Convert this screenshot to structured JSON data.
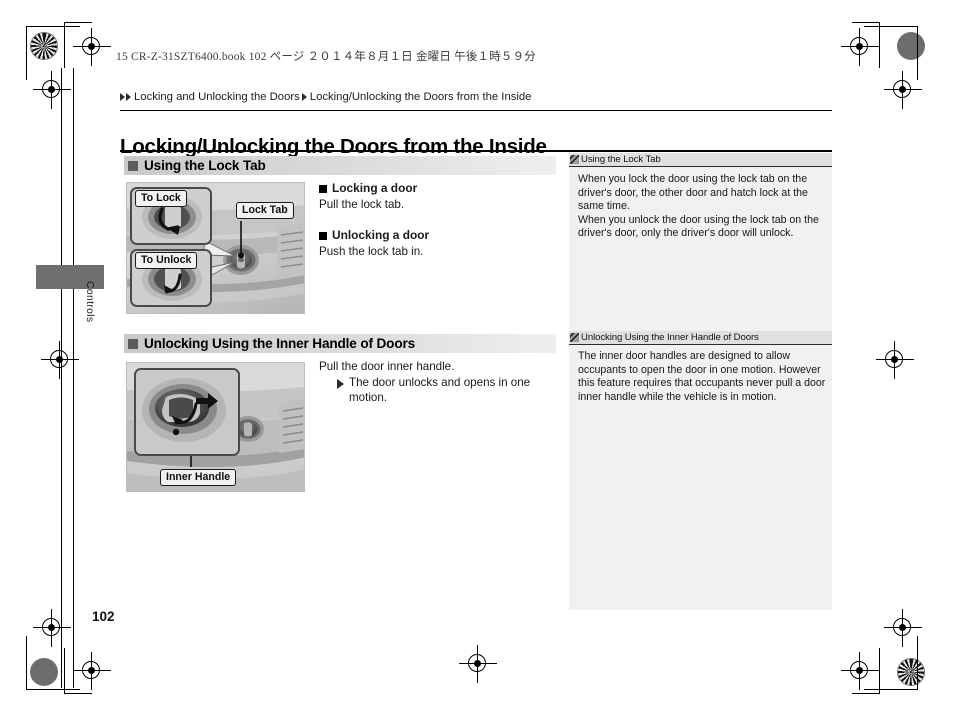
{
  "print_header": "15 CR-Z-31SZT6400.book   102 ページ   ２０１４年８月１日   金曜日   午後１時５９分",
  "breadcrumb": {
    "level1": "Locking and Unlocking the Doors",
    "level2": "Locking/Unlocking the Doors from the Inside"
  },
  "page_title": "Locking/Unlocking the Doors from the Inside",
  "thumb_tab_label": "Controls",
  "folio": "102",
  "sections": [
    {
      "heading": "Using the Lock Tab",
      "illustration": {
        "name": "lock-tab-illustration",
        "callout": "Lock Tab",
        "inset_top_label": "To Lock",
        "inset_bottom_label": "To Unlock"
      },
      "blocks": [
        {
          "subhead": "Locking a door",
          "text": "Pull the lock tab."
        },
        {
          "subhead": "Unlocking a door",
          "text": "Push the lock tab in."
        }
      ]
    },
    {
      "heading": "Unlocking Using the Inner Handle of Doors",
      "illustration": {
        "name": "inner-handle-illustration",
        "callout": "Inner Handle"
      },
      "instruction": "Pull the door inner handle.",
      "result": "The door unlocks and opens in one motion."
    }
  ],
  "sidebar": [
    {
      "heading": "Using the Lock Tab",
      "paragraphs": [
        "When you lock the door using the lock tab on the driver's door, the other door and hatch lock at the same time.",
        "When you unlock the door using the lock tab on the driver's door, only the driver's door will unlock."
      ]
    },
    {
      "heading": "Unlocking Using the Inner Handle of Doors",
      "paragraphs": [
        "The inner door handles are designed to allow occupants to open the door in one motion. However this feature requires that occupants never pull a door inner handle while the vehicle is in motion."
      ]
    }
  ],
  "colors": {
    "section_bar_start": "#c9c9c9",
    "sidebar_bg": "#f1f1f1",
    "sidebar_head_bg": "#e0e0e0",
    "thumb_tab": "#6f6f6f"
  }
}
